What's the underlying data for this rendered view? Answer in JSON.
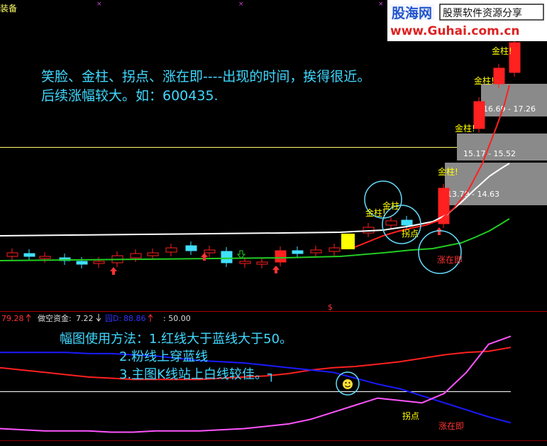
{
  "window": {
    "title": "装备"
  },
  "logo": {
    "brand_cn": "股海网",
    "slogan": "股票软件资源分享",
    "url": "www.Guhai.com.cn"
  },
  "notes": {
    "main_line1": "笑脸、金柱、拐点、涨在即----出现的时间，挨得很近。",
    "main_line2": "后续涨幅较大。如：600435.",
    "sub_line1": "幅图使用方法：1.红线大于蓝线大于50。",
    "sub_line2": "2.粉线上穿蓝线",
    "sub_line3": "3.主图K线站上白线较佳。┐"
  },
  "signals": {
    "jinzhu": "金柱!",
    "jinzhu_plain": "金柱",
    "guaidian": "拐点",
    "zhangzaiji": "涨在即",
    "dollar": "$"
  },
  "price_zones": [
    "16.69 - 17.26",
    "15.17 - 15.52",
    "13.79 - 14.63"
  ],
  "indicator_header": {
    "red_value": "79.28",
    "short_fund_label": "做空资金:",
    "short_fund_value": "7.22",
    "blue_label": "园D:",
    "blue_value": "88.86",
    "level_label": ": 50.00"
  },
  "colors": {
    "background": "#000000",
    "white_line": "#ffffff",
    "green_line": "#22cc22",
    "red_line": "#ff2020",
    "blue_line": "#1a1aff",
    "pink_line": "#ff55ff",
    "note_text": "#40d8ff",
    "signal_text": "#ffff00",
    "zone_fill": "#8a8a8a",
    "circle": "#66ddff",
    "up_candle": "#ff2020",
    "down_candle": "#40e0ff",
    "smiley": "#ffdd33"
  },
  "chart_data": [
    {
      "type": "candlestick",
      "title": "",
      "note": "main price panel, values estimated; last candles near 13.8–18",
      "series": [
        {
          "name": "",
          "color_key": "white_line",
          "values": [
            10.5,
            10.5,
            10.52,
            10.55,
            10.6,
            10.62,
            10.62,
            10.62,
            10.63,
            10.65,
            10.7,
            10.7,
            10.72,
            10.74,
            10.76,
            10.8,
            10.85,
            10.95,
            11.1,
            11.35,
            11.7,
            12.2,
            12.9,
            13.9
          ]
        },
        {
          "name": "",
          "color_key": "green_line",
          "values": [
            9.9,
            9.92,
            9.93,
            9.95,
            9.98,
            10.0,
            10.0,
            10.0,
            10.0,
            10.02,
            10.05,
            10.05,
            10.07,
            10.1,
            10.12,
            10.15,
            10.18,
            10.22,
            10.3,
            10.42,
            10.55,
            10.72,
            10.95,
            11.25
          ]
        },
        {
          "name": "",
          "color_key": "red_line",
          "values": [
            null,
            null,
            null,
            null,
            null,
            null,
            null,
            null,
            null,
            null,
            null,
            null,
            null,
            null,
            null,
            null,
            10.1,
            10.4,
            10.7,
            10.95,
            11.3,
            12.2,
            14.0,
            16.6
          ]
        }
      ]
    },
    {
      "type": "line",
      "title": "",
      "ylim": [
        0,
        100
      ],
      "series": [
        {
          "name": "",
          "color_key": "red_line",
          "values": [
            62,
            60,
            58,
            56,
            54,
            53,
            52,
            52,
            52,
            52,
            53,
            54,
            55,
            57,
            60,
            62,
            63,
            65,
            67,
            70,
            73,
            75,
            76,
            79.28
          ]
        },
        {
          "name": "",
          "color_key": "blue_line",
          "values": [
            75,
            75,
            75,
            75,
            74,
            74,
            73,
            72,
            70,
            68,
            67,
            66,
            64,
            62,
            60,
            58,
            53,
            48,
            44,
            38,
            32,
            26,
            20,
            15
          ]
        },
        {
          "name": "",
          "color_key": "pink_line",
          "values": [
            10,
            9,
            8,
            8,
            8,
            7,
            7,
            8,
            8,
            8,
            9,
            10,
            12,
            14,
            18,
            24,
            30,
            36,
            34,
            32,
            40,
            58,
            82,
            88.86
          ]
        }
      ],
      "levels": [
        50
      ]
    }
  ]
}
